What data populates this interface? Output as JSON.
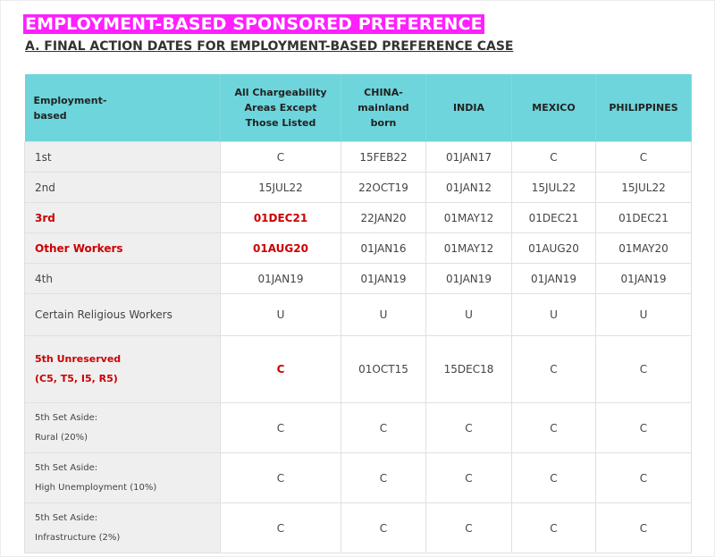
{
  "title": "EMPLOYMENT-BASED SPONSORED PREFERENCE",
  "subtitle": "A. FINAL ACTION DATES FOR EMPLOYMENT-BASED PREFERENCE CASE",
  "colors": {
    "title_bg": "#ff1fff",
    "header_bg": "#6dd5db",
    "highlight_red": "#cc0000"
  },
  "table": {
    "headers": [
      [
        "Employment-",
        "based"
      ],
      [
        "All Chargeability",
        "Areas Except",
        "Those Listed"
      ],
      [
        "CHINA-",
        "mainland",
        "born"
      ],
      [
        "INDIA"
      ],
      [
        "MEXICO"
      ],
      [
        "PHILIPPINES"
      ]
    ],
    "rows": [
      {
        "label": [
          "1st"
        ],
        "cells": [
          "C",
          "15FEB22",
          "01JAN17",
          "C",
          "C"
        ]
      },
      {
        "label": [
          "2nd"
        ],
        "cells": [
          "15JUL22",
          "22OCT19",
          "01JAN12",
          "15JUL22",
          "15JUL22"
        ]
      },
      {
        "label": [
          "3rd"
        ],
        "cells": [
          "01DEC21",
          "22JAN20",
          "01MAY12",
          "01DEC21",
          "01DEC21"
        ]
      },
      {
        "label": [
          "Other Workers"
        ],
        "cells": [
          "01AUG20",
          "01JAN16",
          "01MAY12",
          "01AUG20",
          "01MAY20"
        ]
      },
      {
        "label": [
          "4th"
        ],
        "cells": [
          "01JAN19",
          "01JAN19",
          "01JAN19",
          "01JAN19",
          "01JAN19"
        ]
      },
      {
        "label": [
          "Certain Religious Workers"
        ],
        "cells": [
          "U",
          "U",
          "U",
          "U",
          "U"
        ]
      },
      {
        "label": [
          "5th Unreserved",
          "(C5, T5, I5, R5)"
        ],
        "cells": [
          "C",
          "01OCT15",
          "15DEC18",
          "C",
          "C"
        ]
      },
      {
        "label": [
          "5th Set Aside:",
          "Rural (20%)"
        ],
        "cells": [
          "C",
          "C",
          "C",
          "C",
          "C"
        ]
      },
      {
        "label": [
          "5th Set Aside:",
          "High Unemployment (10%)"
        ],
        "cells": [
          "C",
          "C",
          "C",
          "C",
          "C"
        ]
      },
      {
        "label": [
          "5th Set Aside:",
          "Infrastructure  (2%)"
        ],
        "cells": [
          "C",
          "C",
          "C",
          "C",
          "C"
        ]
      }
    ]
  }
}
